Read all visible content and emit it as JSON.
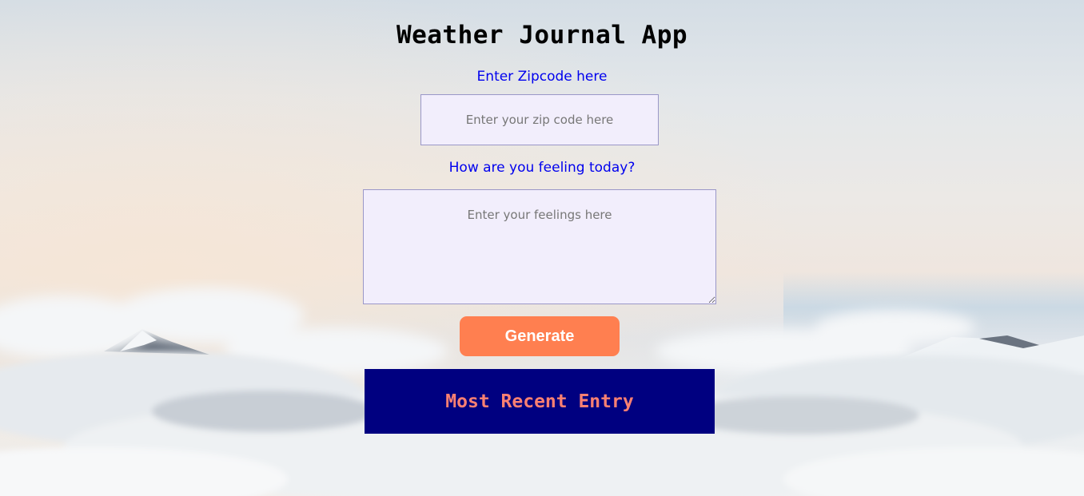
{
  "app": {
    "title": "Weather Journal App"
  },
  "zip": {
    "label": "Enter Zipcode here",
    "placeholder": "Enter your zip code here",
    "value": ""
  },
  "feelings": {
    "label": "How are you feeling today?",
    "placeholder": "Enter your feelings here",
    "value": ""
  },
  "actions": {
    "generate_label": "Generate"
  },
  "entry": {
    "title": "Most Recent Entry"
  },
  "colors": {
    "label_text": "#0000ee",
    "input_bg": "#f2eefc",
    "button_bg": "#ff7f50",
    "panel_bg": "#000080",
    "panel_text": "#fa8072"
  },
  "background": {
    "icon": "sky-clouds-mountains-image"
  }
}
